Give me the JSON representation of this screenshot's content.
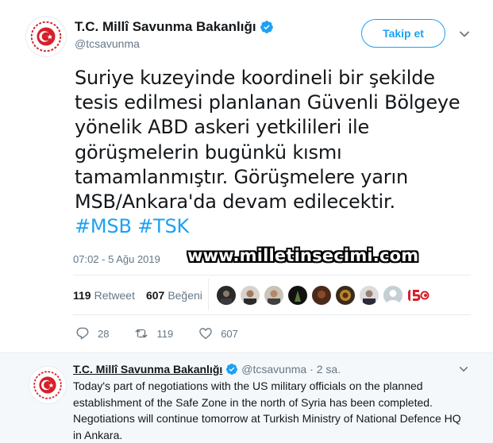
{
  "account": {
    "name": "T.C. Millî Savunma Bakanlığı",
    "handle": "@tcsavunma"
  },
  "follow_button": {
    "label": "Takip et"
  },
  "tweet": {
    "lines": [
      "Suriye kuzeyinde koordineli bir şekilde",
      "tesis edilmesi planlanan Güvenli Bölgeye",
      "yönelik ABD askeri yetkilileri ile",
      "görüşmelerin bugünkü kısmı",
      "tamamlanmıştır. Görüşmelere yarın",
      "MSB/Ankara'da devam edilecektir."
    ],
    "hashtags": "#MSB #TSK",
    "timestamp": "07:02 - 5 Ağu 2019"
  },
  "watermark": "www.milletinsecimi.com",
  "stats": {
    "retweets_count": "119",
    "retweets_label": "Retweet",
    "likes_count": "607",
    "likes_label": "Beğeni"
  },
  "actions": {
    "reply_count": "28",
    "retweet_count": "119",
    "like_count": "607"
  },
  "reply": {
    "name": "T.C. Millî Savunma Bakanlığı",
    "handle": "@tcsavunma",
    "time": "· 2 sa.",
    "text": "Today's part of negotiations with the US military officials on the planned establishment of the Safe Zone in the north of Syria has been completed. Negotiations will continue tomorrow at Turkish Ministry of National Defence HQ in Ankara."
  },
  "colors": {
    "accent": "#1da1f2",
    "emblem_red": "#d6202a",
    "muted": "#657786"
  }
}
